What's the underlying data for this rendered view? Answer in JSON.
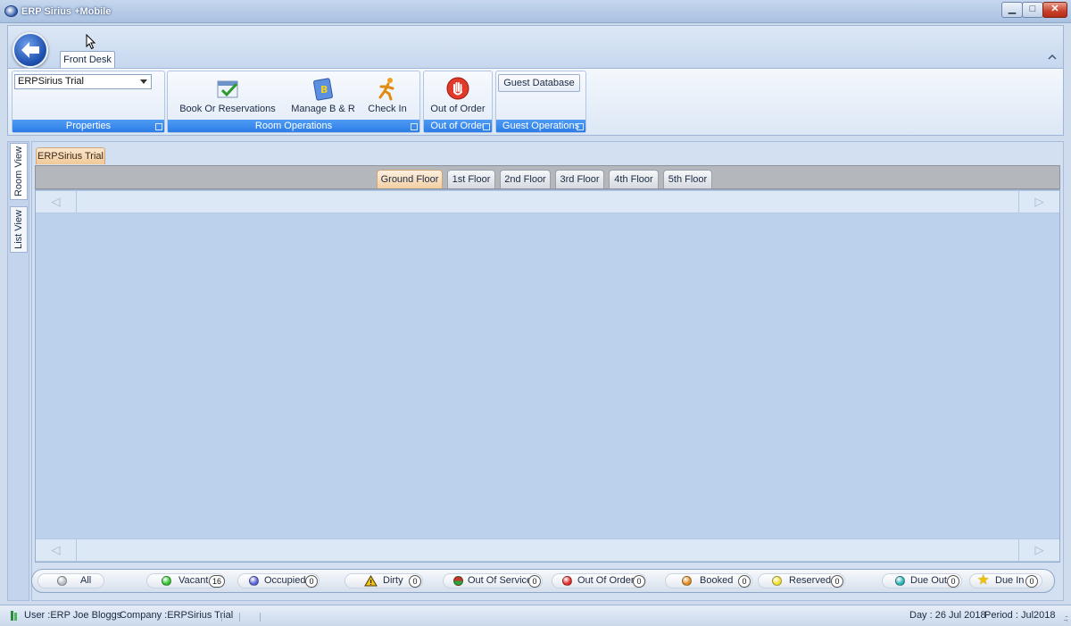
{
  "window": {
    "title": "ERP Sirius +Mobile",
    "minimize": "▁",
    "maximize": "□",
    "close": "✕"
  },
  "ribbon": {
    "app_button_icon": "back-arrow-icon",
    "tabs": [
      {
        "label": "Front Desk"
      }
    ],
    "collapse_icon": "chevron-up-icon",
    "groups": {
      "properties": {
        "label": "Properties",
        "selected": "ERPSirius Trial"
      },
      "room_operations": {
        "label": "Room Operations",
        "buttons": [
          {
            "label": "Book Or Reservations",
            "icon": "calendar-check-icon"
          },
          {
            "label": "Manage B & R",
            "icon": "book-b-icon"
          },
          {
            "label": "Check In",
            "icon": "running-person-icon"
          }
        ]
      },
      "out_of_order": {
        "label": "Out of Order",
        "buttons": [
          {
            "label": "Out of Order",
            "icon": "stop-hand-icon"
          }
        ]
      },
      "guest_operations": {
        "label": "Guest Operations",
        "buttons": [
          {
            "label": "Guest Database"
          }
        ]
      }
    }
  },
  "side_tabs": [
    {
      "label": "Room View"
    },
    {
      "label": "List View"
    }
  ],
  "document_tab": "ERPSirius Trial",
  "floors": [
    {
      "label": "Ground Floor",
      "active": true
    },
    {
      "label": "1st Floor"
    },
    {
      "label": "2nd Floor"
    },
    {
      "label": "3rd Floor"
    },
    {
      "label": "4th Floor"
    },
    {
      "label": "5th Floor"
    }
  ],
  "nav": {
    "prev": "◁",
    "next": "▷"
  },
  "legend": [
    {
      "label": "All",
      "color": "#b8bfc9"
    },
    {
      "label": "Vacant",
      "count": "16",
      "color": "#2fc42f"
    },
    {
      "label": "Occupied",
      "count": "0",
      "color": "#5a63d8"
    },
    {
      "label": "Dirty",
      "count": "0",
      "color": "#e8c21a"
    },
    {
      "label": "Out Of Service",
      "count": "0",
      "color": "#c0392b"
    },
    {
      "label": "Out Of Order",
      "count": "0",
      "color": "#e02a2a"
    },
    {
      "label": "Booked",
      "count": "0",
      "color": "#e08a1e"
    },
    {
      "label": "Reserved",
      "count": "0",
      "color": "#f2e22a"
    },
    {
      "label": "Due Out",
      "count": "0",
      "color": "#2bb3b8"
    },
    {
      "label": "Due In",
      "count": "0",
      "color": "#f2c200"
    }
  ],
  "status": {
    "user": "User :ERP Joe Bloggs",
    "company": "Company :ERPSirius Trial",
    "day": "Day : 26 Jul 2018",
    "period": "Period : Jul2018"
  }
}
